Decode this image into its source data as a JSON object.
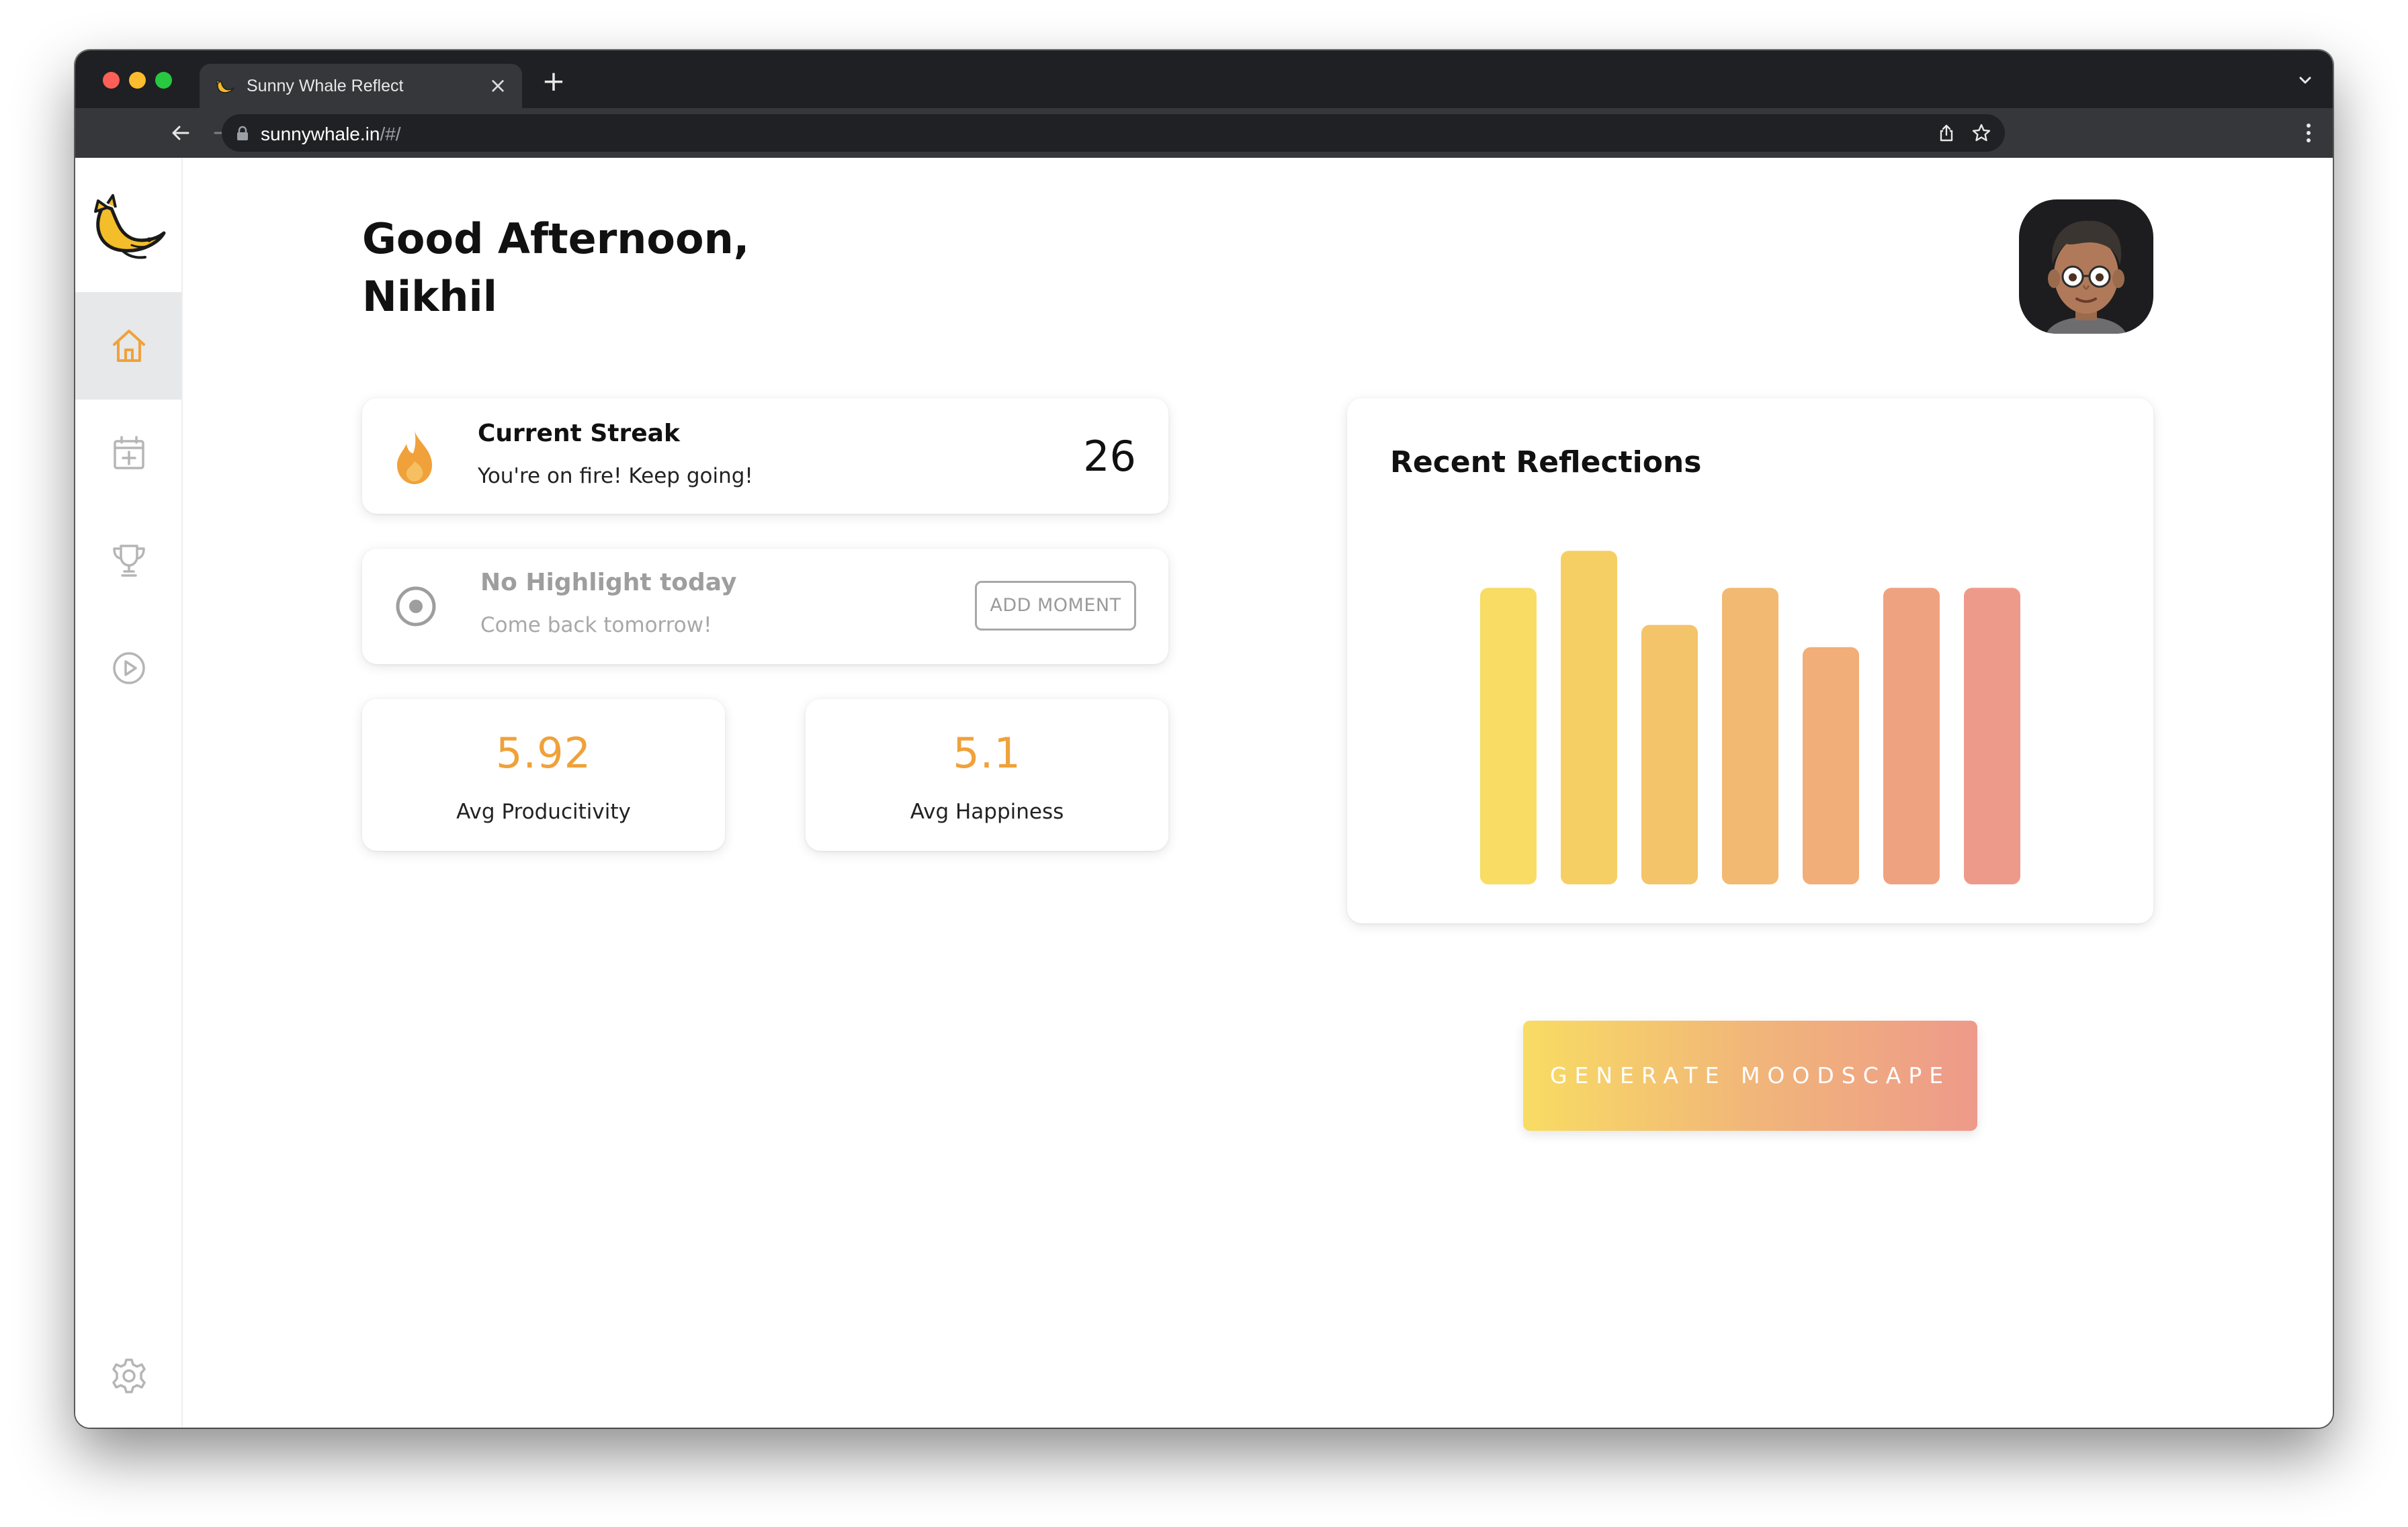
{
  "browser": {
    "tab_title": "Sunny Whale Reflect",
    "url_host": "sunnywhale.in",
    "url_path": "/#/"
  },
  "greeting": {
    "line1": "Good Afternoon,",
    "line2": "Nikhil"
  },
  "streak": {
    "title": "Current Streak",
    "subtitle": "You're on fire! Keep going!",
    "count": "26"
  },
  "highlight": {
    "title": "No Highlight today",
    "subtitle": "Come back tomorrow!",
    "button_label": "ADD MOMENT"
  },
  "stats": {
    "productivity_value": "5.92",
    "productivity_label": "Avg Producitivity",
    "happiness_value": "5.1",
    "happiness_label": "Avg Happiness"
  },
  "reflections": {
    "title": "Recent Reflections"
  },
  "generate_button": "GENERATE MOODSCAPE",
  "colors": {
    "accent_orange": "#f0a13a",
    "gradient_start": "#f8dc63",
    "gradient_end": "#ee9a8a"
  },
  "sidebar": {
    "items": [
      {
        "icon": "home-icon",
        "active": true
      },
      {
        "icon": "calendar-add-icon",
        "active": false
      },
      {
        "icon": "trophy-icon",
        "active": false
      },
      {
        "icon": "play-circle-icon",
        "active": false
      }
    ],
    "bottom_icon": "gear-icon"
  },
  "chart_data": {
    "type": "bar",
    "title": "Recent Reflections",
    "values": [
      8,
      9,
      7,
      8,
      6.4,
      8,
      8
    ],
    "ylim": [
      0,
      10
    ],
    "bar_colors": [
      "#f8dc63",
      "#f6cf64",
      "#f4c46a",
      "#f2b972",
      "#f1ae78",
      "#efa280",
      "#ee9a8a"
    ],
    "grid": false,
    "axes_visible": false
  }
}
